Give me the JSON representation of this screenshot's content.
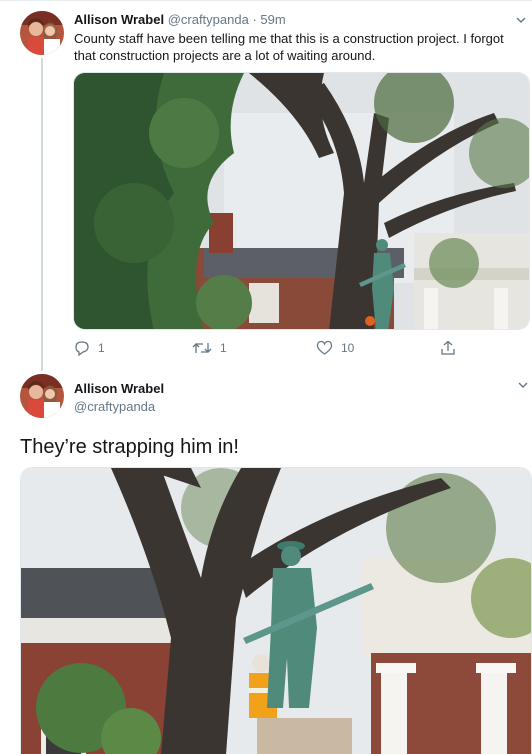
{
  "tweet1": {
    "author_name": "Allison Wrabel",
    "handle": "@craftypanda",
    "separator": " · ",
    "time": "59m",
    "text": "County staff have been telling me that this is a construction project. I forgot that construction projects are a lot of waiting around.",
    "actions": {
      "reply_count": "1",
      "retweet_count": "1",
      "like_count": "10"
    }
  },
  "tweet2": {
    "author_name": "Allison Wrabel",
    "handle": "@craftypanda",
    "text": "They’re strapping him in!"
  },
  "icons": {
    "reply": "reply-icon",
    "retweet": "retweet-icon",
    "like": "heart-icon",
    "share": "share-icon",
    "menu": "chevron-down-icon"
  },
  "colors": {
    "text_primary": "#14171a",
    "text_secondary": "#657786",
    "thread_line": "#cfd9de"
  }
}
